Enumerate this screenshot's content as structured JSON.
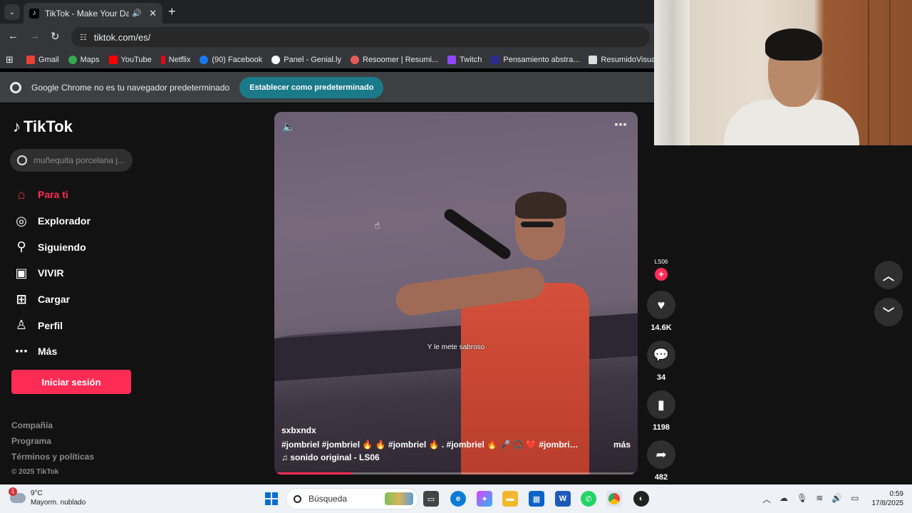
{
  "browser": {
    "tab_title": "TikTok - Make Your Day",
    "url": "tiktok.com/es/",
    "bookmarks": [
      "Gmail",
      "Maps",
      "YouTube",
      "Netflix",
      "(90) Facebook",
      "Panel - Genial.ly",
      "Resoomer | Resumi...",
      "Twitch",
      "Pensamiento abstra...",
      "ResumidoVisualBasi..."
    ],
    "infobar_text": "Google Chrome no es tu navegador predeterminado",
    "infobar_button": "Establecer como predeterminado"
  },
  "tiktok": {
    "logo": "TikTok",
    "search_placeholder": "muñequita porcelana j...",
    "nav": [
      "Para ti",
      "Explorador",
      "Siguiendo",
      "VIVIR",
      "Cargar",
      "Perfil",
      "Más"
    ],
    "login": "Iniciar sesión",
    "footer": [
      "Compañía",
      "Programa",
      "Términos y políticas"
    ],
    "copyright": "© 2025 TikTok"
  },
  "video": {
    "subtitle": "Y le mete sabroso",
    "author": "sxbxndx",
    "hashtags": "#jombriel #jombriel 🔥 🔥 #jombriel 🔥 . #jombriel 🔥 🎤 🎧 ❤️ #jombriel ...",
    "more": "más",
    "sound": "sonido original - LS06",
    "progress": 0.21
  },
  "actions": {
    "avatar_label": "LS06",
    "likes": "14.6K",
    "comments": "34",
    "saves": "1198",
    "shares": "482"
  },
  "taskbar": {
    "temp": "9°C",
    "weather": "Mayorm. nublado",
    "weather_badge": "1",
    "search": "Búsqueda",
    "time": "0:59",
    "date": "17/8/2025"
  },
  "colors": {
    "tiktok_red": "#fe2c55",
    "page_bg": "#121212",
    "chrome_dark": "#35363a"
  }
}
